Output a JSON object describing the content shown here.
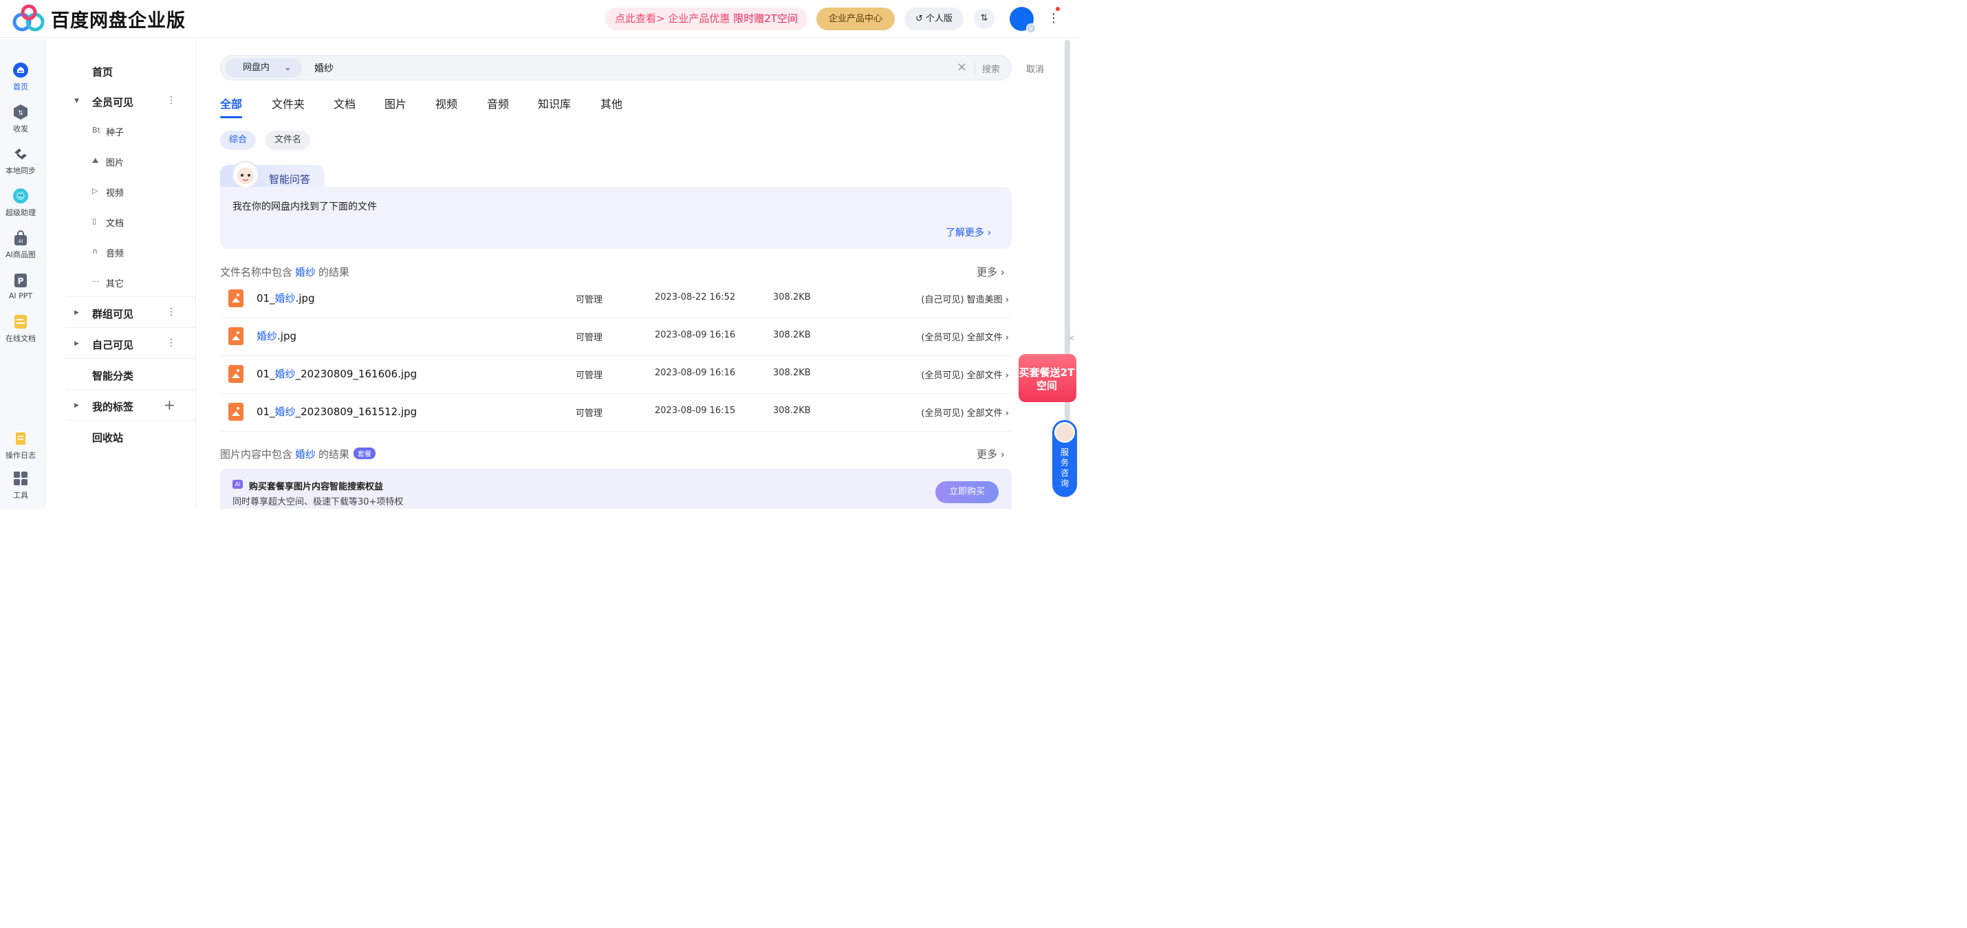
{
  "header": {
    "brand": "百度网盘企业版",
    "promo_a": "点此查看> 企业产品优惠",
    "promo_b": "限时赠2T空间",
    "biz_center": "企业产品中心",
    "personal": "个人版",
    "transfer": "⇅"
  },
  "rail": [
    {
      "label": "首页",
      "icon": "home-icon"
    },
    {
      "label": "收发",
      "icon": "transfer-icon"
    },
    {
      "label": "本地同步",
      "icon": "sync-icon"
    },
    {
      "label": "超级助理",
      "icon": "assistant-icon"
    },
    {
      "label": "AI商品图",
      "icon": "bag-icon"
    },
    {
      "label": "AI PPT",
      "icon": "ppt-icon"
    },
    {
      "label": "在线文档",
      "icon": "doc-icon"
    },
    {
      "label": "操作日志",
      "icon": "log-icon"
    },
    {
      "label": "工具",
      "icon": "apps-icon"
    }
  ],
  "tree": {
    "home": "首页",
    "all_visible": "全员可见",
    "sub": [
      {
        "icon": "Bt",
        "label": "种子"
      },
      {
        "icon": "⛰",
        "label": "图片"
      },
      {
        "icon": "▷",
        "label": "视频"
      },
      {
        "icon": "▯",
        "label": "文档"
      },
      {
        "icon": "∩",
        "label": "音频"
      },
      {
        "icon": "···",
        "label": "其它"
      }
    ],
    "group_visible": "群组可见",
    "self_visible": "自己可见",
    "smart_category": "智能分类",
    "my_tags": "我的标签",
    "recycle": "回收站"
  },
  "search": {
    "scope": "网盘内",
    "query": "婚纱",
    "button": "搜索",
    "cancel": "取消"
  },
  "tabs": [
    "全部",
    "文件夹",
    "文档",
    "图片",
    "视频",
    "音频",
    "知识库",
    "其他"
  ],
  "filters": [
    "综合",
    "文件名"
  ],
  "qa": {
    "title": "智能问答",
    "text": "我在你的网盘内找到了下面的文件",
    "more": "了解更多 ›"
  },
  "section1": {
    "pre": "文件名称中包含",
    "kw": "婚纱",
    "post": "的结果",
    "more": "更多 ›"
  },
  "files": [
    {
      "prefix": "01_",
      "hl": "婚纱",
      "suffix": ".jpg",
      "perm": "可管理",
      "date": "2023-08-22 16:52",
      "size": "308.2KB",
      "loc": "(自己可见) 智造美图 ›"
    },
    {
      "prefix": "",
      "hl": "婚纱",
      "suffix": ".jpg",
      "perm": "可管理",
      "date": "2023-08-09 16:16",
      "size": "308.2KB",
      "loc": "(全员可见) 全部文件 ›"
    },
    {
      "prefix": "01_",
      "hl": "婚纱",
      "suffix": "_20230809_161606.jpg",
      "perm": "可管理",
      "date": "2023-08-09 16:16",
      "size": "308.2KB",
      "loc": "(全员可见) 全部文件 ›"
    },
    {
      "prefix": "01_",
      "hl": "婚纱",
      "suffix": "_20230809_161512.jpg",
      "perm": "可管理",
      "date": "2023-08-09 16:15",
      "size": "308.2KB",
      "loc": "(全员可见) 全部文件 ›"
    }
  ],
  "section2": {
    "pre": "图片内容中包含",
    "kw": "婚纱",
    "post": "的结果",
    "badge": "套餐",
    "more": "更多 ›"
  },
  "upsell": {
    "ai_tag": "AI",
    "title": "购买套餐享图片内容智能搜索权益",
    "sub": "同时尊享超大空间、极速下载等30+项特权",
    "button": "立即购买"
  },
  "float_gift": {
    "text": "买套餐送2T空间"
  },
  "service": {
    "text": "服务咨询"
  },
  "colors": {
    "accent": "#1a5cf0",
    "file_icon": "#f57e3d",
    "promo": "#f2456d"
  }
}
